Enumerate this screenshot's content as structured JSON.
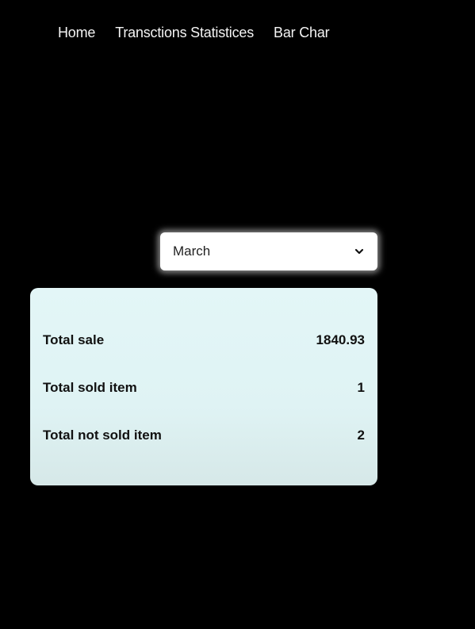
{
  "nav": {
    "items": [
      {
        "label": "Home"
      },
      {
        "label": "Transctions Statistices"
      },
      {
        "label": "Bar Char"
      }
    ]
  },
  "month_select": {
    "value": "March",
    "icon": "chevron-down-icon"
  },
  "stats": [
    {
      "label": "Total sale",
      "value": "1840.93"
    },
    {
      "label": "Total sold item",
      "value": "1"
    },
    {
      "label": "Total not sold item",
      "value": "2"
    }
  ]
}
